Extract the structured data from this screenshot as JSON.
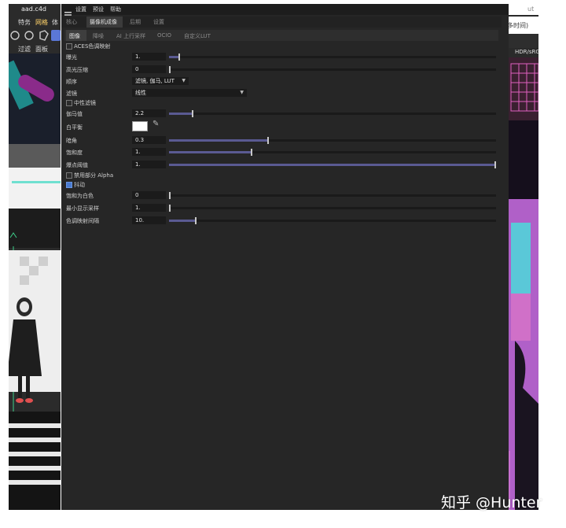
{
  "left_app": {
    "title": "aad.c4d",
    "top_labels": [
      "特务",
      "网格",
      "体"
    ],
    "sub_labels": [
      "过滤",
      "面板"
    ]
  },
  "right_app": {
    "top_text": "ut",
    "time_label": "多时间)",
    "hdr_label": "HDR/sRG"
  },
  "menu": [
    "设置",
    "预设",
    "帮助"
  ],
  "tabs_top": [
    "核心",
    "摄像机成像",
    "后期",
    "设置"
  ],
  "tabs_sub": [
    "图像",
    "降噪",
    "AI 上行采样",
    "OCIO",
    "自定义LUT"
  ],
  "aces_label": "ACES色调映射",
  "exposure": {
    "label": "曝光",
    "value": "1.",
    "level": 0.03
  },
  "highlight": {
    "label": "高光压缩",
    "value": "0",
    "level": 0.0
  },
  "order": {
    "label": "顺序",
    "value": "滤镜, 伽马, LUT"
  },
  "filter": {
    "label": "滤镜",
    "value": "线性"
  },
  "neutral_label": "中性滤镜",
  "gamma": {
    "label": "伽马值",
    "value": "2.2",
    "level": 0.07
  },
  "white_balance": {
    "label": "白平衡",
    "color": "#ffffff"
  },
  "vignette": {
    "label": "暗角",
    "value": "0.3",
    "level": 0.3
  },
  "saturation": {
    "label": "饱和度",
    "value": "1.",
    "level": 0.25
  },
  "hot_pixel": {
    "label": "爆点阈值",
    "value": "1.",
    "level": 1.0
  },
  "disable_alpha_label": "禁用部分 Alpha",
  "dither_label": "抖动",
  "sat_to_white": {
    "label": "饱和为白色",
    "value": "0",
    "level": 0.0
  },
  "min_samples": {
    "label": "最小显示采样",
    "value": "1.",
    "level": 0.0
  },
  "tonemap_interval": {
    "label": "色调映射间隔",
    "value": "10.",
    "level": 0.08
  },
  "watermark": "知乎 @Hunter",
  "colors": {
    "slider_fill": "#5a5a92",
    "panel": "#262626",
    "accent_tab": "#3b3b3b"
  }
}
